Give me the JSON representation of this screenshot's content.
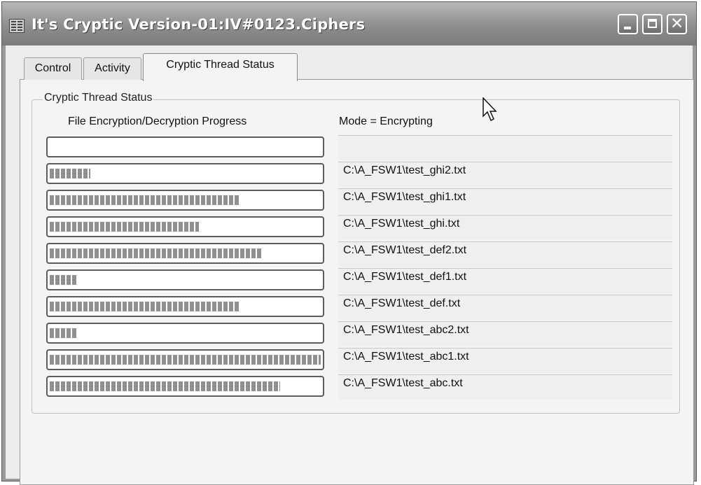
{
  "window": {
    "title": "It's Cryptic Version-01:IV#0123.Ciphers"
  },
  "tabs": [
    {
      "label": "Control",
      "active": false
    },
    {
      "label": "Activity",
      "active": false
    },
    {
      "label": "Cryptic Thread Status",
      "active": true
    }
  ],
  "group": {
    "title": "Cryptic Thread Status",
    "progress_header": "File Encryption/Decryption Progress",
    "mode_label": "Mode = Encrypting"
  },
  "rows": [
    {
      "progress": 0.0,
      "file": ""
    },
    {
      "progress": 0.15,
      "file": "C:\\A_FSW1\\test_ghi2.txt"
    },
    {
      "progress": 0.7,
      "file": "C:\\A_FSW1\\test_ghi1.txt"
    },
    {
      "progress": 0.55,
      "file": "C:\\A_FSW1\\test_ghi.txt"
    },
    {
      "progress": 0.78,
      "file": "C:\\A_FSW1\\test_def2.txt"
    },
    {
      "progress": 0.1,
      "file": "C:\\A_FSW1\\test_def1.txt"
    },
    {
      "progress": 0.7,
      "file": "C:\\A_FSW1\\test_def.txt"
    },
    {
      "progress": 0.1,
      "file": "C:\\A_FSW1\\test_abc2.txt"
    },
    {
      "progress": 1.0,
      "file": "C:\\A_FSW1\\test_abc1.txt"
    },
    {
      "progress": 0.85,
      "file": "C:\\A_FSW1\\test_abc.txt"
    }
  ],
  "icons": {
    "app": "app-icon",
    "minimize": "minimize-icon",
    "maximize": "maximize-icon",
    "close": "close-icon",
    "cursor": "mouse-pointer-icon"
  },
  "colors": {
    "titlebar": "#8e8e8e",
    "progress_fill": "#8f8f8f",
    "panel": "#f4f4f4"
  }
}
